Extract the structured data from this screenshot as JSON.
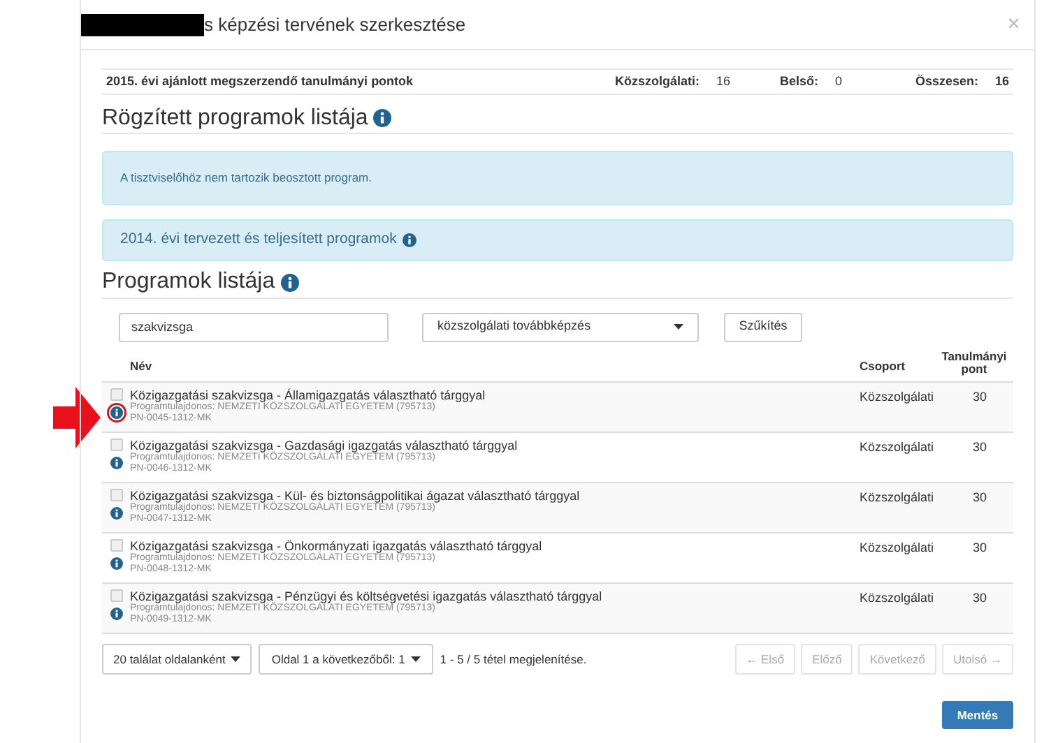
{
  "dialog": {
    "title": "s képzési tervének szerkesztése",
    "title_redacted": true,
    "close": "×"
  },
  "summary": {
    "label": "2015. évi ajánlott megszerzendő tanulmányi pontok",
    "items": [
      {
        "label": "Közszolgálati:",
        "value": "16",
        "bold_value": false
      },
      {
        "label": "Belső:",
        "value": "0",
        "bold_value": false
      },
      {
        "label": "Összesen:",
        "value": "16",
        "bold_value": true
      }
    ]
  },
  "fixed_section": {
    "heading": "Rögzített programok listája",
    "alert": "A tisztviselőhöz nem tartozik beosztott program."
  },
  "previous_year": {
    "text": "2014. évi tervezett és teljesített programok"
  },
  "programs": {
    "heading": "Programok listája",
    "search": {
      "value": "szakvizsga"
    },
    "category": {
      "value": "közszolgálati továbbképzés"
    },
    "filter_button": "Szűkítés",
    "columns": [
      {
        "label": "Név"
      },
      {
        "label": "Csoport"
      },
      {
        "label": "Tanulmányi pont"
      }
    ],
    "rows": [
      {
        "name": "Közigazgatási szakvizsga - Államigazgatás választható tárggyal",
        "owner": "Programtulajdonos: NEMZETI KÖZSZOLGÁLATI EGYETEM (795713)",
        "code": "PN-0045-1312-MK",
        "group": "Közszolgálati",
        "points": "30",
        "checked": false,
        "highlighted": true
      },
      {
        "name": "Közigazgatási szakvizsga - Gazdasági igazgatás választható tárggyal",
        "owner": "Programtulajdonos: NEMZETI KÖZSZOLGÁLATI EGYETEM (795713)",
        "code": "PN-0046-1312-MK",
        "group": "Közszolgálati",
        "points": "30",
        "checked": false,
        "highlighted": false
      },
      {
        "name": "Közigazgatási szakvizsga - Kül- és biztonságpolitikai ágazat választható tárggyal",
        "owner": "Programtulajdonos: NEMZETI KÖZSZOLGÁLATI EGYETEM (795713)",
        "code": "PN-0047-1312-MK",
        "group": "Közszolgálati",
        "points": "30",
        "checked": false,
        "highlighted": false
      },
      {
        "name": "Közigazgatási szakvizsga - Önkormányzati igazgatás választható tárggyal",
        "owner": "Programtulajdonos: NEMZETI KÖZSZOLGÁLATI EGYETEM (795713)",
        "code": "PN-0048-1312-MK",
        "group": "Közszolgálati",
        "points": "30",
        "checked": false,
        "highlighted": false
      },
      {
        "name": "Közigazgatási szakvizsga - Pénzügyi és költségvetési igazgatás választható tárggyal",
        "owner": "Programtulajdonos: NEMZETI KÖZSZOLGÁLATI EGYETEM (795713)",
        "code": "PN-0049-1312-MK",
        "group": "Közszolgálati",
        "points": "30",
        "checked": false,
        "highlighted": false
      }
    ],
    "pagination": {
      "page_size": "20 találat oldalanként",
      "page": "Oldal 1 a következőből: 1",
      "info": "1 - 5 / 5 tétel megjelenítése.",
      "nav": [
        {
          "label": "← Első",
          "disabled": true
        },
        {
          "label": "Előző",
          "disabled": true
        },
        {
          "label": "Következő",
          "disabled": true
        },
        {
          "label": "Utolsó →",
          "disabled": true
        }
      ]
    }
  },
  "save_button": "Mentés"
}
